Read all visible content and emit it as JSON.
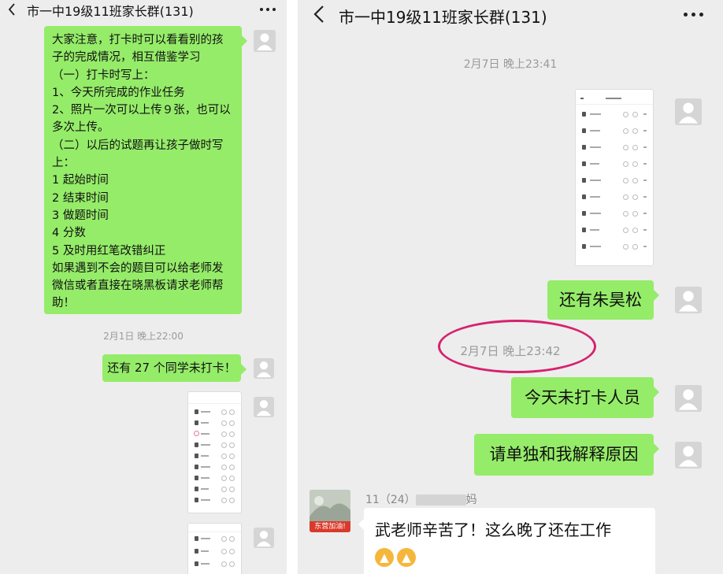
{
  "left": {
    "title": "市一中19级11班家长群(131)",
    "notice_lines": [
      "大家注意，打卡时可以看看别的孩",
      "子的完成情况，相互借鉴学习",
      "（一）打卡时写上：",
      "1、今天所完成的作业任务",
      "2、照片一次可以上传９张，也可以",
      "多次上传。",
      "（二）以后的试题再让孩子做时写",
      "上：",
      "1 起始时间",
      "2 结束时间",
      "3 做题时间",
      "4 分数",
      "5 及时用红笔改错纠正",
      "如果遇到不会的题目可以给老师发",
      "微信或者直接在晓黑板请求老师帮",
      "助！"
    ],
    "timestamp": "2月1日 晚上22:00",
    "msg_unchecked": "还有 27 个同学未打卡！"
  },
  "right": {
    "title": "市一中19级11班家长群(131)",
    "timestamp1": "2月7日 晚上23:41",
    "msg_name": "还有朱昊松",
    "timestamp2": "2月7日 晚上23:42",
    "msg_today": "今天未打卡人员",
    "msg_explain": "请单独和我解释原因",
    "reply_nick": "11（24）",
    "reply_nick_suffix": "妈",
    "reply_text": "武老师辛苦了！这么晚了还在工作",
    "reply_emoji": "👍",
    "avatar_badge": "东营加油!"
  },
  "colors": {
    "chat_bg": "#ededed",
    "bubble_green": "#95ec69",
    "highlight_circle": "#d6226e"
  }
}
